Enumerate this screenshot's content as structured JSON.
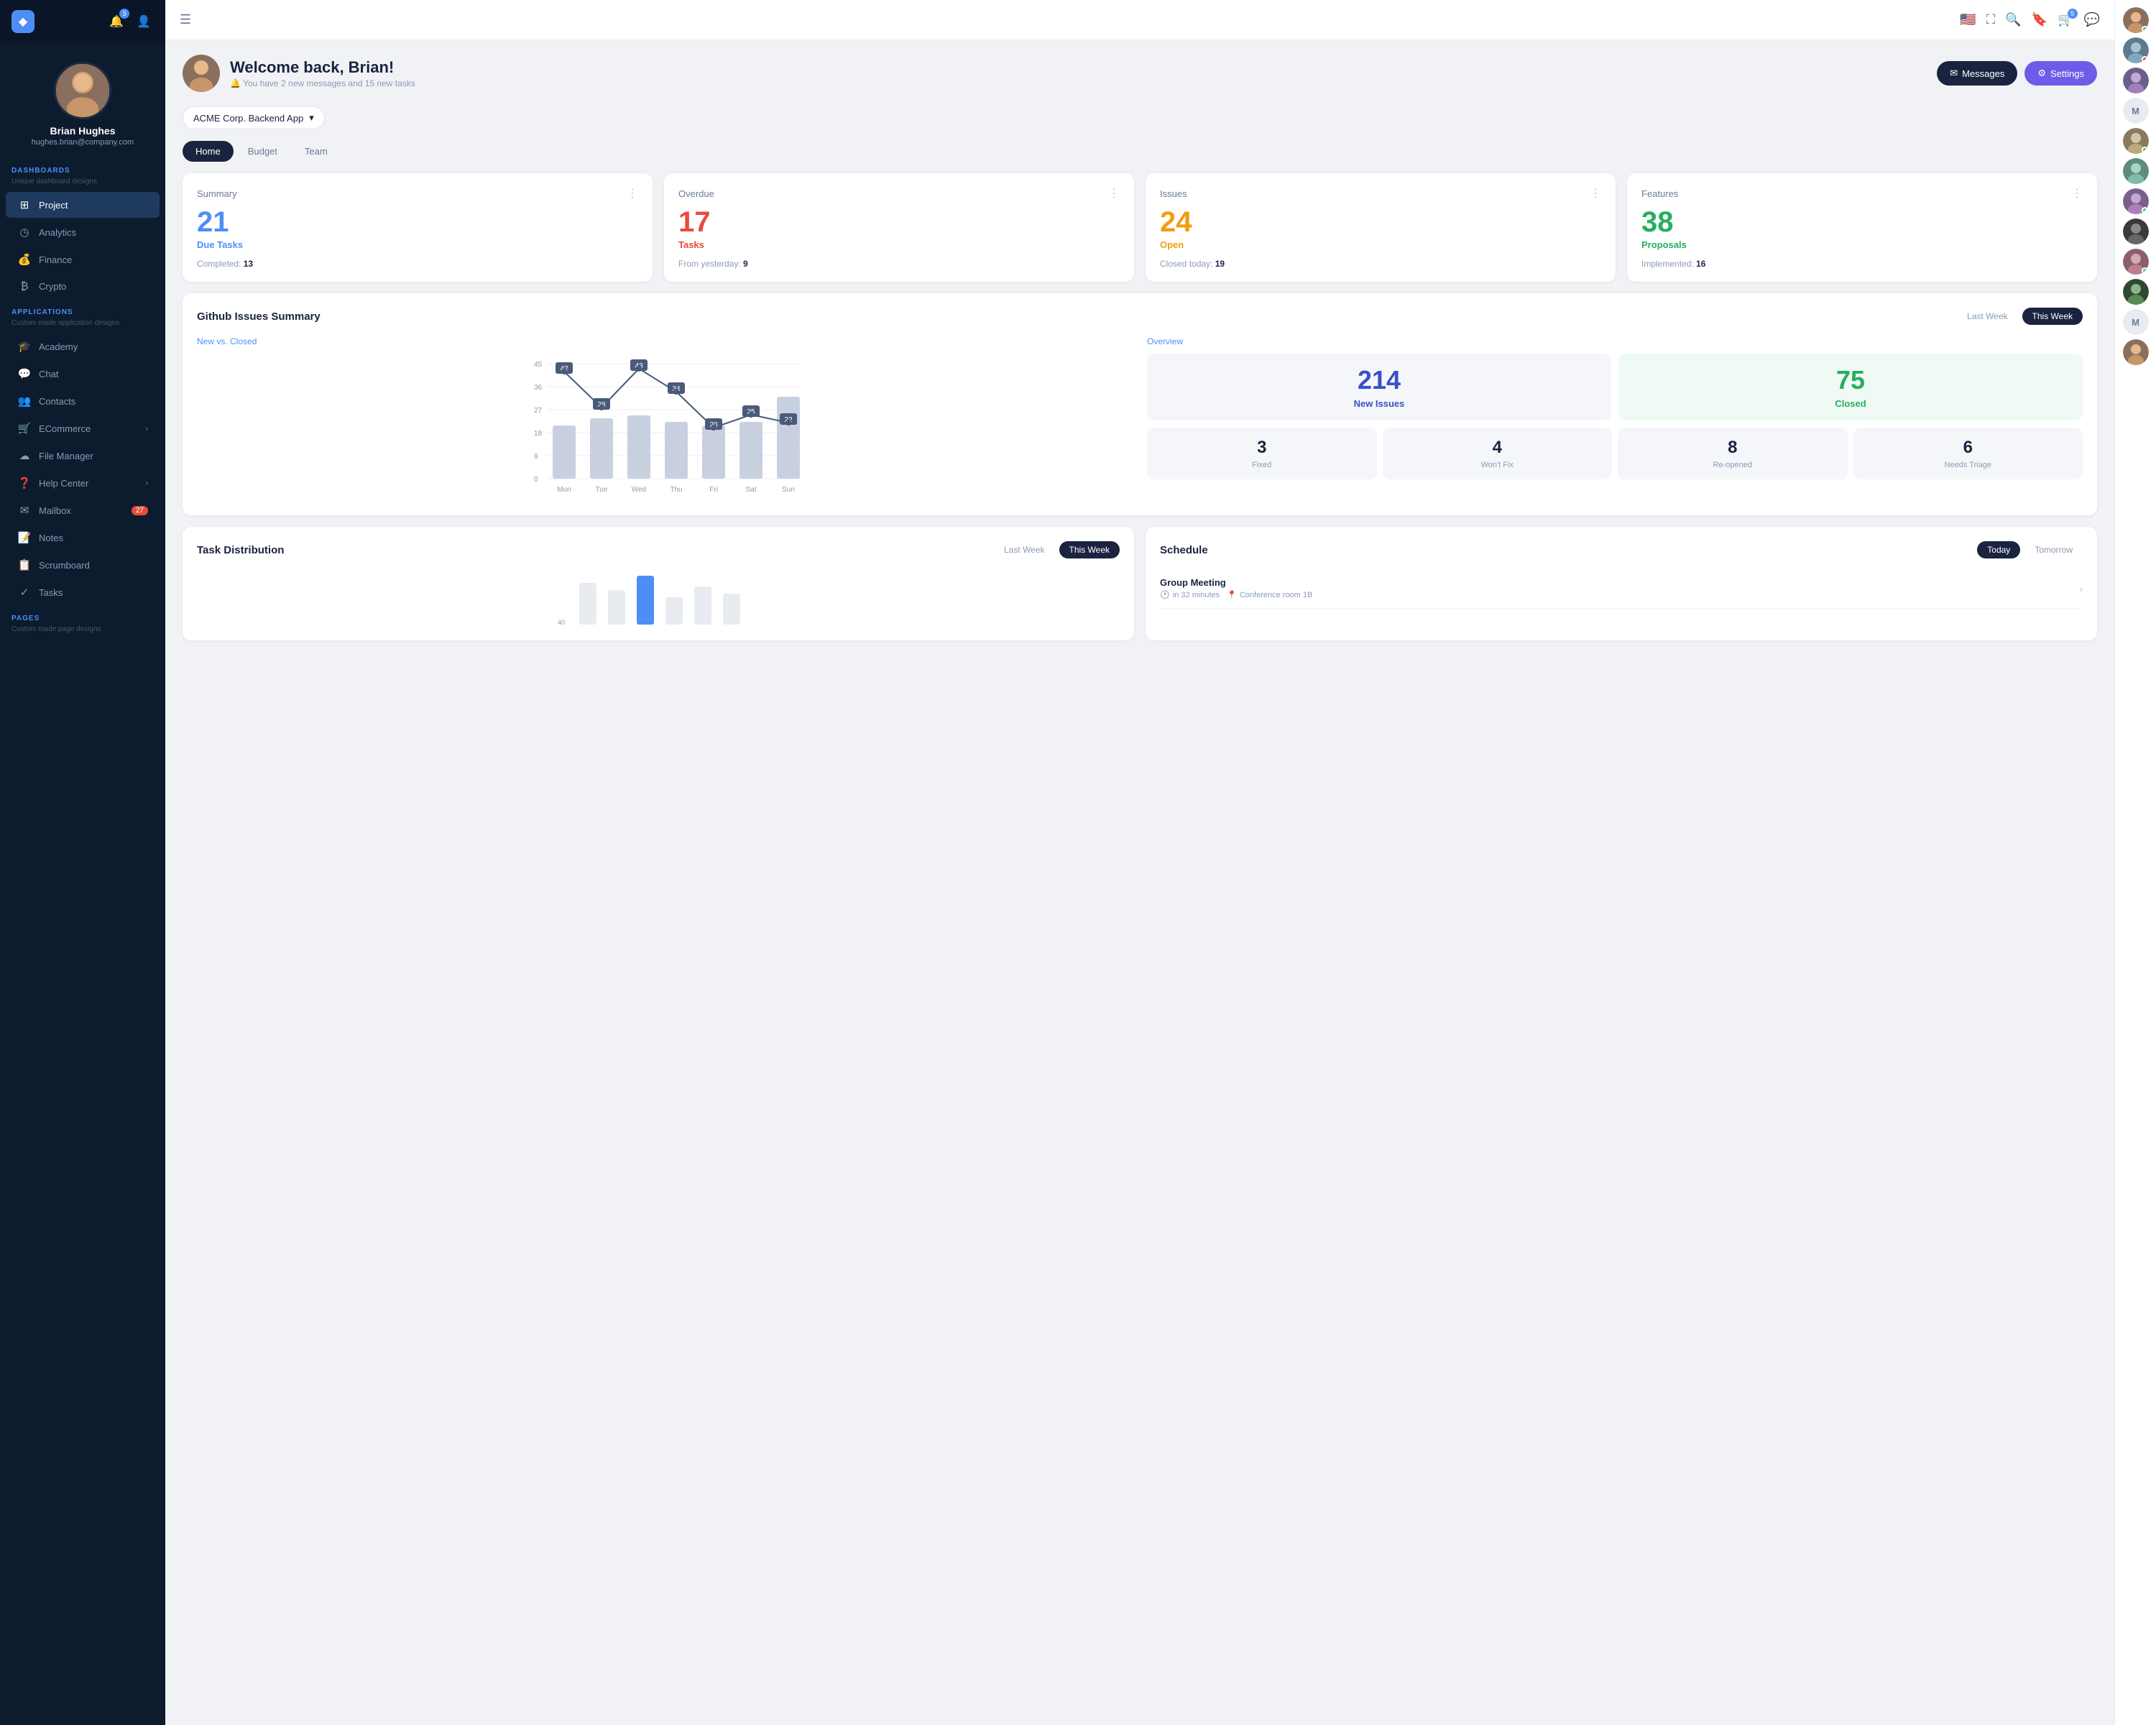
{
  "sidebar": {
    "logo": "◆",
    "notification_count": "3",
    "user": {
      "name": "Brian Hughes",
      "email": "hughes.brian@company.com"
    },
    "dashboards_label": "DASHBOARDS",
    "dashboards_sub": "Unique dashboard designs",
    "dashboard_items": [
      {
        "id": "project",
        "icon": "⊞",
        "label": "Project",
        "active": true
      },
      {
        "id": "analytics",
        "icon": "◷",
        "label": "Analytics",
        "active": false
      },
      {
        "id": "finance",
        "icon": "$",
        "label": "Finance",
        "active": false
      },
      {
        "id": "crypto",
        "icon": "₿",
        "label": "Crypto",
        "active": false
      }
    ],
    "applications_label": "APPLICATIONS",
    "applications_sub": "Custom made application designs",
    "app_items": [
      {
        "id": "academy",
        "icon": "🎓",
        "label": "Academy",
        "badge": null
      },
      {
        "id": "chat",
        "icon": "💬",
        "label": "Chat",
        "badge": null
      },
      {
        "id": "contacts",
        "icon": "👥",
        "label": "Contacts",
        "badge": null
      },
      {
        "id": "ecommerce",
        "icon": "🛒",
        "label": "ECommerce",
        "badge": null,
        "arrow": true
      },
      {
        "id": "filemanager",
        "icon": "☁",
        "label": "File Manager",
        "badge": null
      },
      {
        "id": "helpcenter",
        "icon": "❓",
        "label": "Help Center",
        "badge": null,
        "arrow": true
      },
      {
        "id": "mailbox",
        "icon": "✉",
        "label": "Mailbox",
        "badge": "27"
      },
      {
        "id": "notes",
        "icon": "📝",
        "label": "Notes",
        "badge": null
      },
      {
        "id": "scrumboard",
        "icon": "📋",
        "label": "Scrumboard",
        "badge": null
      },
      {
        "id": "tasks",
        "icon": "✓",
        "label": "Tasks",
        "badge": null
      }
    ],
    "pages_label": "PAGES",
    "pages_sub": "Custom made page designs"
  },
  "topbar": {
    "hamburger": "☰",
    "flag": "🇺🇸",
    "fullscreen": "⛶",
    "search": "🔍",
    "bookmark": "🔖",
    "cart_badge": "5",
    "message": "💬"
  },
  "header": {
    "welcome_title": "Welcome back, Brian!",
    "welcome_sub": "You have 2 new messages and 15 new tasks",
    "btn_messages": "Messages",
    "btn_settings": "Settings"
  },
  "project_selector": {
    "label": "ACME Corp. Backend App"
  },
  "tabs": [
    {
      "id": "home",
      "label": "Home",
      "active": true
    },
    {
      "id": "budget",
      "label": "Budget",
      "active": false
    },
    {
      "id": "team",
      "label": "Team",
      "active": false
    }
  ],
  "stats": [
    {
      "title": "Summary",
      "number": "21",
      "number_color": "blue",
      "label": "Due Tasks",
      "label_color": "blue",
      "footer_key": "Completed:",
      "footer_val": "13"
    },
    {
      "title": "Overdue",
      "number": "17",
      "number_color": "red",
      "label": "Tasks",
      "label_color": "red",
      "footer_key": "From yesterday:",
      "footer_val": "9"
    },
    {
      "title": "Issues",
      "number": "24",
      "number_color": "orange",
      "label": "Open",
      "label_color": "orange",
      "footer_key": "Closed today:",
      "footer_val": "19"
    },
    {
      "title": "Features",
      "number": "38",
      "number_color": "green",
      "label": "Proposals",
      "label_color": "green",
      "footer_key": "Implemented:",
      "footer_val": "16"
    }
  ],
  "github": {
    "title": "Github Issues Summary",
    "toggle": {
      "last_week": "Last Week",
      "this_week": "This Week"
    },
    "chart": {
      "label": "New vs. Closed",
      "y_labels": [
        "45",
        "36",
        "27",
        "18",
        "9",
        "0"
      ],
      "x_labels": [
        "Mon",
        "Tue",
        "Wed",
        "Thu",
        "Fri",
        "Sat",
        "Sun"
      ],
      "line_points": [
        {
          "x": 42,
          "label": "42"
        },
        {
          "x": 28,
          "label": "28"
        },
        {
          "x": 43,
          "label": "43"
        },
        {
          "x": 34,
          "label": "34"
        },
        {
          "x": 20,
          "label": "20"
        },
        {
          "x": 25,
          "label": "25"
        },
        {
          "x": 22,
          "label": "22"
        }
      ],
      "bar_heights": [
        70,
        60,
        75,
        55,
        45,
        50,
        90
      ]
    },
    "overview": {
      "label": "Overview",
      "new_issues": "214",
      "new_issues_label": "New Issues",
      "closed": "75",
      "closed_label": "Closed",
      "mini": [
        {
          "num": "3",
          "label": "Fixed"
        },
        {
          "num": "4",
          "label": "Won't Fix"
        },
        {
          "num": "8",
          "label": "Re-opened"
        },
        {
          "num": "6",
          "label": "Needs Triage"
        }
      ]
    }
  },
  "task_distribution": {
    "title": "Task Distribution",
    "toggle": {
      "last_week": "Last Week",
      "this_week": "This Week"
    }
  },
  "schedule": {
    "title": "Schedule",
    "toggle": {
      "today": "Today",
      "tomorrow": "Tomorrow"
    },
    "items": [
      {
        "title": "Group Meeting",
        "time": "in 32 minutes",
        "location": "Conference room 1B"
      }
    ]
  },
  "right_panel": {
    "avatars": [
      "user1",
      "user2",
      "user3",
      "user4",
      "user5",
      "user6",
      "user7",
      "user8",
      "user9",
      "user10",
      "user11"
    ],
    "letters": [
      "M",
      "M"
    ]
  }
}
